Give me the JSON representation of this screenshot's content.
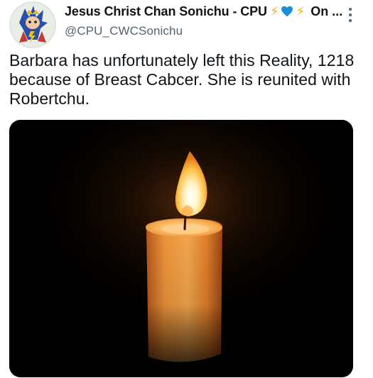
{
  "tweet": {
    "author": {
      "display_name": "Jesus Christ Chan Sonichu - CPU",
      "name_emoji": [
        "lightning-bolt",
        "blue-heart",
        "lightning-bolt"
      ],
      "name_suffix": "On ...",
      "handle": "@CPU_CWCSonichu",
      "avatar_icon": "sonichu-avatar-icon"
    },
    "more_icon": "more-options-icon",
    "text": "Barbara has unfortunately left this Reality, 1218 because of Breast Cabcer. She is reunited with Robertchu.",
    "media": {
      "type": "photo",
      "subject_icon": "lit-candle-icon"
    }
  },
  "colors": {
    "name": "#0f1419",
    "handle": "#536471",
    "bolt": "#f4b400",
    "heart": "#1d8fd6",
    "media_bg": "#000000",
    "candle": "#f29a3a"
  }
}
